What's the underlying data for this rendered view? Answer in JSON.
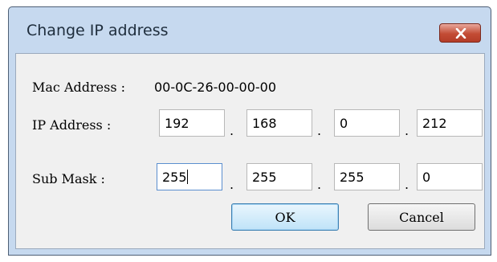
{
  "window": {
    "title": "Change IP address",
    "close_icon": "close-icon"
  },
  "mac": {
    "label": "Mac Address :",
    "value": "00-0C-26-00-00-00"
  },
  "ip": {
    "label": "IP Address :",
    "octets": [
      "192",
      "168",
      "0",
      "212"
    ]
  },
  "mask": {
    "label": "Sub Mask :",
    "octets": [
      "255",
      "255",
      "255",
      "0"
    ]
  },
  "separator": ".",
  "buttons": {
    "ok": "OK",
    "cancel": "Cancel"
  },
  "colors": {
    "title_bar": "#c6d9ef",
    "client_bg": "#f0f0f0",
    "close_button": "#c34c35",
    "ok_border": "#3c7fb1"
  }
}
